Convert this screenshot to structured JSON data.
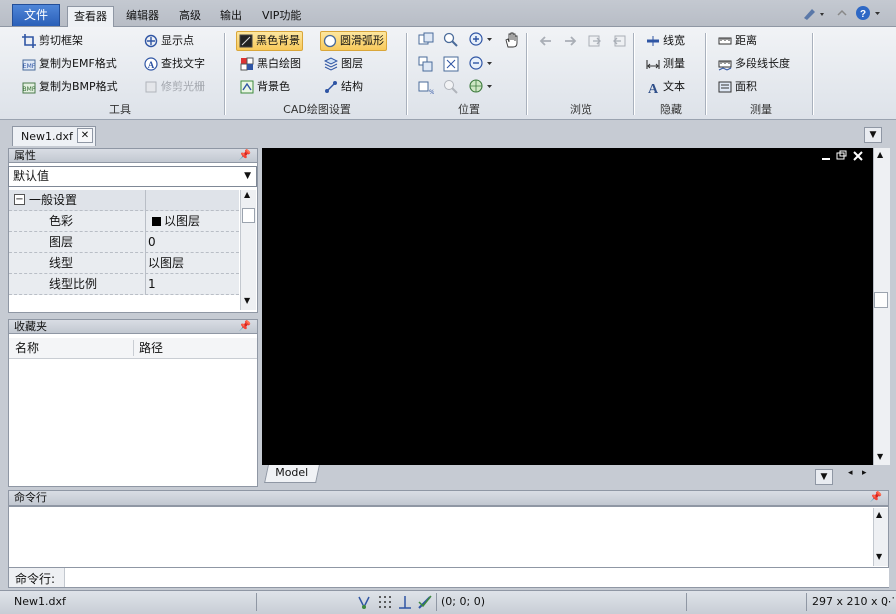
{
  "menu": {
    "file": "文件",
    "tabs": [
      "查看器",
      "编辑器",
      "高级",
      "输出",
      "VIP功能"
    ]
  },
  "ribbon": {
    "tools": {
      "label": "工具",
      "buttons": [
        "剪切框架",
        "复制为EMF格式",
        "复制为BMP格式",
        "显示点",
        "查找文字",
        "修剪光栅"
      ]
    },
    "cad": {
      "label": "CAD绘图设置",
      "buttons": [
        "黑色背景",
        "黑白绘图",
        "背景色",
        "圆滑弧形",
        "图层",
        "结构"
      ]
    },
    "position": {
      "label": "位置"
    },
    "browse": {
      "label": "浏览"
    },
    "hide": {
      "label": "隐藏",
      "buttons": [
        "线宽",
        "测量",
        "文本"
      ]
    },
    "measure": {
      "label": "测量",
      "buttons": [
        "距离",
        "多段线长度",
        "面积"
      ]
    }
  },
  "document": {
    "tab": "New1.dxf"
  },
  "properties": {
    "title": "属性",
    "select": "默认值",
    "group": "一般设置",
    "rows": [
      {
        "name": "色彩",
        "value": "以图层"
      },
      {
        "name": "图层",
        "value": "0"
      },
      {
        "name": "线型",
        "value": "以图层"
      },
      {
        "name": "线型比例",
        "value": "1"
      }
    ]
  },
  "favorites": {
    "title": "收藏夹",
    "columns": [
      "名称",
      "路径"
    ]
  },
  "canvas": {
    "model_tab": "Model"
  },
  "command": {
    "title": "命令行",
    "prompt": "命令行:"
  },
  "status": {
    "file": "New1.dxf",
    "coords": "(0; 0; 0)",
    "size": "297 x 210 x 0"
  },
  "colors": {
    "file_tab": "#2a5fb8",
    "highlight": "#f8c95a",
    "canvas": "#000000"
  }
}
